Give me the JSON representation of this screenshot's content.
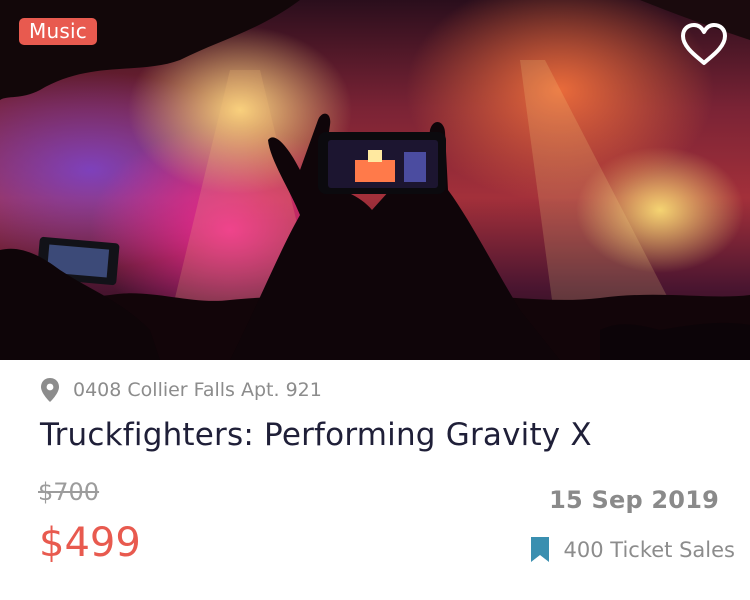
{
  "hero": {
    "category_tag": "Music",
    "favorite_icon": "heart-outline-icon"
  },
  "event": {
    "location": "0408 Collier Falls Apt. 921",
    "location_icon": "map-pin-icon",
    "title": "Truckfighters: Performing Gravity X",
    "original_price": "$700",
    "price": "$499",
    "date": "15 Sep 2019",
    "ticket_sales": "400 Ticket Sales",
    "ticket_icon": "bookmark-icon"
  },
  "colors": {
    "accent": "#e85a4f",
    "title": "#1f1f38",
    "muted": "#8c8c8c",
    "bookmark": "#3a8fb0"
  }
}
